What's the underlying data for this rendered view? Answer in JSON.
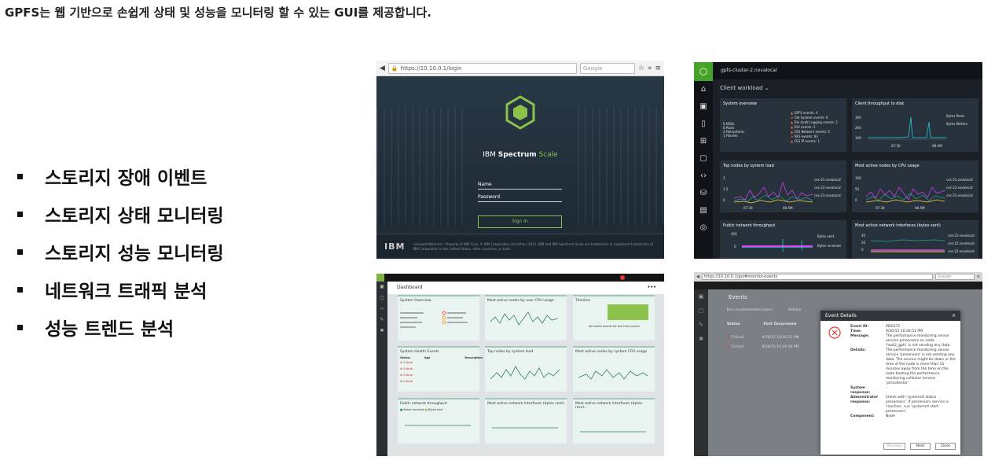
{
  "heading": "GPFS는 웹 기반으로 손쉽게 상태 및 성능을 모니터링 할 수 있는 GUI를 제공합니다.",
  "bullets": [
    "스토리지 장애 이벤트",
    "스토리지 상태 모니터링",
    "스토리지 성능 모니터링",
    "네트워크 트래픽 분석",
    "성능 트렌드 분석"
  ],
  "login": {
    "url": "https://10.10.0.1/login",
    "search_placeholder": "Google",
    "brand": "IBM",
    "product": "Spectrum",
    "product_suffix": "Scale",
    "name_label": "Name",
    "password_label": "Password",
    "signin_label": "Sign in",
    "footer_logo": "IBM",
    "footer_text": "Licensed Materials - Property of IBM Corp. © IBM Corporation and others 2015. IBM and IBM Spectrum Scale are trademarks or registered trademarks of IBM Corporation in the United States, other countries, or both."
  },
  "dark_dash": {
    "cluster": "gpfs-cluster-2.novalocal",
    "view": "Client workload ⌄",
    "cards": {
      "overview": {
        "title": "System overview",
        "stats": [
          "6 NSDs",
          "6 Pools",
          "3 Filesystems",
          "1 Filesets"
        ],
        "events": [
          "GPFS events: 4",
          "File System events: 6",
          "File Audit Logging events: 2",
          "GUI events: 3",
          "CES Network events: 5",
          "NFS events: 82",
          "CES IP events: 1"
        ]
      },
      "throughput": {
        "title": "Client throughput to disk",
        "legend": [
          "Bytes Read",
          "Bytes Written"
        ],
        "yticks": [
          "300",
          "200",
          "100"
        ],
        "xticks": [
          "07:30",
          "08 AM"
        ]
      },
      "topnodes": {
        "title": "Top nodes by system load",
        "legend": [
          "ces-21.novalocal",
          "ces-22.novalocal",
          "ces-23.novalocal"
        ],
        "yticks": [
          "3",
          "1.5",
          "0"
        ],
        "xticks": [
          "07:30",
          "08 AM"
        ]
      },
      "cpu": {
        "title": "Most active nodes by CPU usage",
        "legend": [
          "ces-21.novalocal",
          "ces-22.novalocal",
          "ces-23.novalocal"
        ],
        "yticks": [
          "100",
          "50",
          "0"
        ],
        "xticks": [
          "07:30",
          "08 AM"
        ]
      },
      "netpub": {
        "title": "Public network throughput",
        "legend": [
          "Bytes sent",
          "Bytes received"
        ],
        "yticks": [
          "450",
          "0"
        ]
      },
      "netif": {
        "title": "Most active network interfaces (bytes sent)",
        "legend": [
          "ces-21.novalocal",
          "ces-22.novalocal",
          "ces-22.novalocal"
        ],
        "yticks": [
          "40",
          "20",
          "0"
        ]
      }
    }
  },
  "light_dash": {
    "title": "Dashboard",
    "more": "•••",
    "cards": [
      {
        "title": "System Overview"
      },
      {
        "title": "Most active nodes by user CPU usage"
      },
      {
        "title": "Timeline",
        "note": "No health events for this time period"
      },
      {
        "title": "System Health Events",
        "cols": [
          "Status",
          "Age",
          "Description"
        ],
        "rows": [
          "Critical",
          "Critical",
          "Critical",
          "Critical"
        ]
      },
      {
        "title": "Top nodes by system load"
      },
      {
        "title": "Most active nodes by system CPU usage"
      },
      {
        "title": "Public network throughput",
        "legend": [
          "Bytes received",
          "Bytes sent"
        ]
      },
      {
        "title": "Most active network interfaces (bytes sent)"
      },
      {
        "title": "Most active network interfaces (bytes recei..."
      }
    ]
  },
  "events": {
    "url": "https://10.10.0.1/gui#monitor-events",
    "search_placeholder": "Google",
    "title": "Events",
    "toolbar": [
      "Run recommended action",
      "Actions"
    ],
    "cols": [
      "Status",
      "First Occurrence"
    ],
    "rows": [
      {
        "status": "Critical",
        "time": "9/30/15 10:26:51 PM"
      },
      {
        "status": "Critical",
        "time": "9/30/15 10:26:30 PM"
      }
    ],
    "modal": {
      "title": "Event Details",
      "close": "×",
      "fields": [
        {
          "k": "Event ID:",
          "v": "MS0372"
        },
        {
          "k": "Time:",
          "v": "9/30/15 10:26:51 PM"
        },
        {
          "k": "Message:",
          "v": "The performance monitoring sensor service pmsensors on node 'host2_gpfs' is not sending any data."
        },
        {
          "k": "Details:",
          "v": "The performance monitoring sensor service 'pmsensors' is not sending any data. The service might be down or the time of the node is more than 15 minutes away from the time on the node hosting the performance monitoring collector service 'pmcollector'."
        },
        {
          "k": "System response:",
          "v": "-"
        },
        {
          "k": "Administrator response:",
          "v": "Check with 'systemctl status pmsensors'. If pmsensors service is 'inactive', run 'systemctl start pmsensors'."
        },
        {
          "k": "Component:",
          "v": "Node"
        }
      ],
      "buttons": [
        "Previous",
        "Next",
        "Close"
      ]
    }
  },
  "colors": {
    "ibm_green": "#8bc34a",
    "critical": "#e53935",
    "warning": "#ff7043",
    "dark_bg": "#1b2026"
  }
}
